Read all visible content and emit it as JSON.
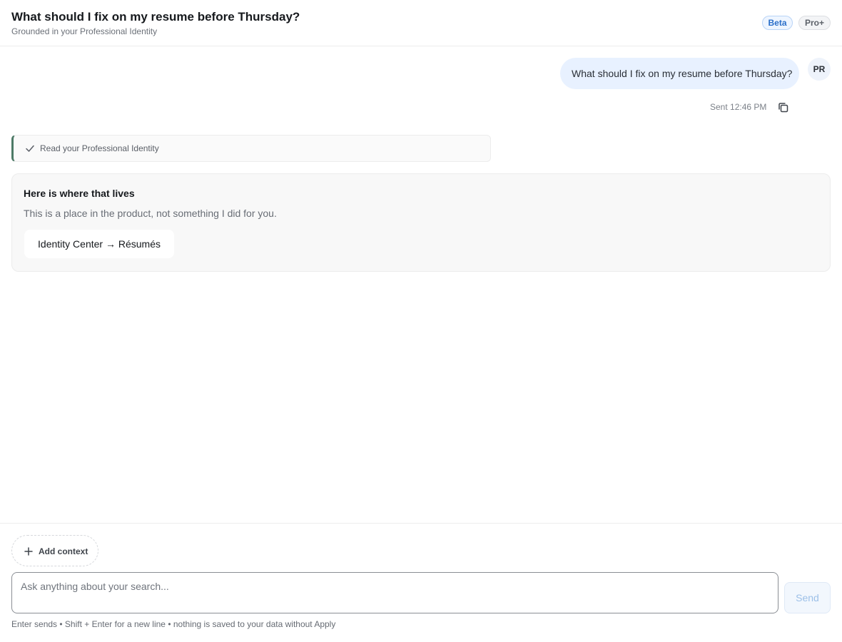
{
  "header": {
    "title": "What should I fix on my resume before Thursday?",
    "subtitle": "Grounded in your Professional Identity",
    "badges": [
      "Beta",
      "Pro+"
    ]
  },
  "messages": {
    "user": {
      "text": "What should I fix on my resume before Thursday?",
      "avatar": "PR",
      "sent_label": "Sent 12:46 PM",
      "copy_icon": "copy-icon"
    },
    "tool_step": {
      "icon": "check-icon",
      "label": "Read your Professional Identity"
    },
    "assistant_card": {
      "title": "Here is where that lives",
      "description": "This is a place in the product, not something I did for you.",
      "link_label": "Identity Center → Résumés"
    }
  },
  "composer": {
    "add_context_icon": "plus-icon",
    "add_context_label": "Add context",
    "input_value": "",
    "input_placeholder": "Ask anything about your search...",
    "send_label": "Send",
    "hint": "Enter sends • Shift + Enter for a new line • nothing is saved to your data without Apply"
  },
  "colors": {
    "user_bubble": "#e8f1ff",
    "step_accent": "#4d7a66",
    "beta_badge": "#2a6fc9",
    "send_disabled": "#9dc0e8"
  }
}
